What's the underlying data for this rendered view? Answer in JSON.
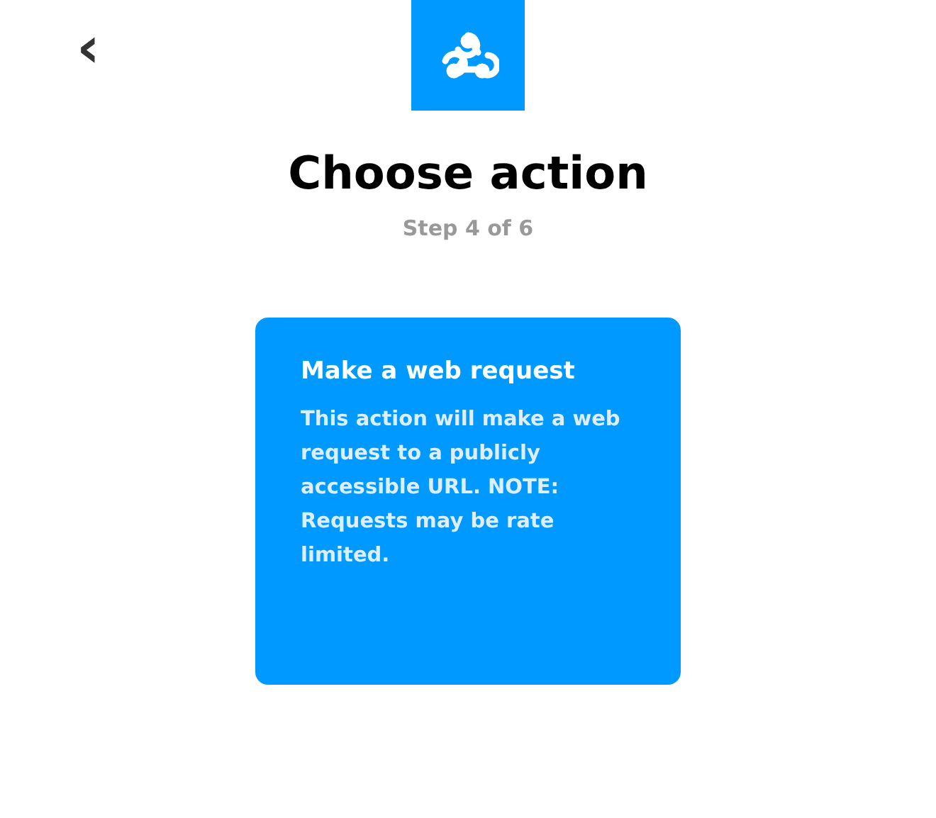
{
  "header": {
    "back": "‹",
    "title": "Choose action",
    "step": "Step 4 of 6"
  },
  "actions": [
    {
      "title": "Make a web request",
      "description": "This action will make a web request to a publicly accessible URL. NOTE: Requests may be rate limited."
    }
  ]
}
